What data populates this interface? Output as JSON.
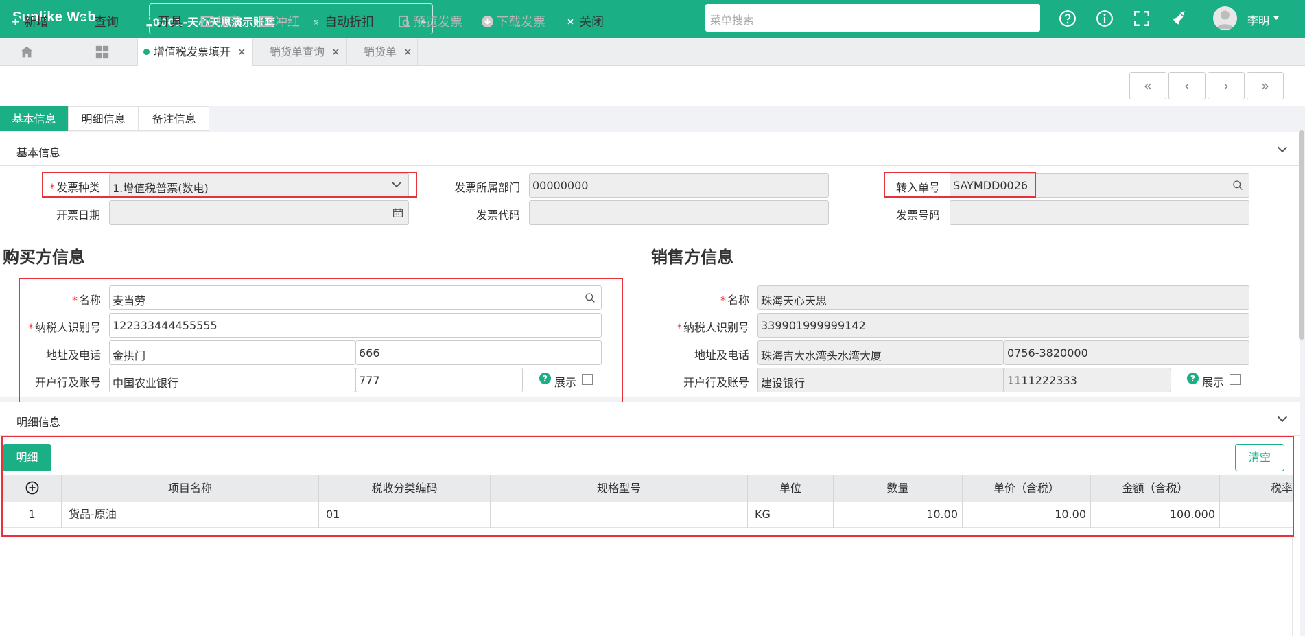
{
  "app": {
    "brand": "Sunlike Web",
    "account": "0001-天心天思演示账套",
    "search_placeholder": "菜单搜索",
    "user": "李明"
  },
  "top_icons": [
    "help-circle-icon",
    "info-circle-icon",
    "fullscreen-icon",
    "clear-cache-icon"
  ],
  "tabs": [
    {
      "label": "增值税发票填开",
      "active": true
    },
    {
      "label": "销货单查询",
      "active": false
    },
    {
      "label": "销货单",
      "active": false
    }
  ],
  "toolbar": {
    "new": "新增",
    "query": "查询",
    "issue": "开具",
    "red": "红字",
    "offset": "冲红",
    "auto_discount": "自动折扣",
    "preview": "预览发票",
    "download": "下载发票",
    "close": "关闭"
  },
  "subtabs": [
    "基本信息",
    "明细信息",
    "备注信息"
  ],
  "basic": {
    "section_title": "基本信息",
    "invoice_type_label": "发票种类",
    "invoice_type_value": "1.增值税普票(数电)",
    "dept_label": "发票所属部门",
    "dept_value": "00000000",
    "transfer_label": "转入单号",
    "transfer_value": "SAYMDD0026",
    "date_label": "开票日期",
    "code_label": "发票代码",
    "number_label": "发票号码"
  },
  "buyer": {
    "title": "购买方信息",
    "name_label": "名称",
    "name": "麦当劳",
    "tax_label": "纳税人识别号",
    "tax": "122333444455555",
    "addr_label": "地址及电话",
    "addr": "金拱门",
    "phone": "666",
    "bank_label": "开户行及账号",
    "bank": "中国农业银行",
    "account": "777",
    "show_label": "展示"
  },
  "seller": {
    "title": "销售方信息",
    "name_label": "名称",
    "name": "珠海天心天思",
    "tax_label": "纳税人识别号",
    "tax": "339901999999142",
    "addr_label": "地址及电话",
    "addr": "珠海吉大水湾头水湾大厦",
    "phone": "0756-3820000",
    "bank_label": "开户行及账号",
    "bank": "建设银行",
    "account": "1111222333",
    "show_label": "展示"
  },
  "detail": {
    "section_title": "明细信息",
    "detail_btn": "明细",
    "clear_btn": "清空",
    "columns": [
      "项目名称",
      "税收分类编码",
      "规格型号",
      "单位",
      "数量",
      "单价（含税）",
      "金额（含税）",
      "税率"
    ],
    "rows": [
      {
        "no": "1",
        "name": "货品-原油",
        "code": "01",
        "spec": "",
        "unit": "KG",
        "qty": "10.00",
        "price": "10.00",
        "amount": "100.000",
        "rate": ""
      }
    ]
  }
}
